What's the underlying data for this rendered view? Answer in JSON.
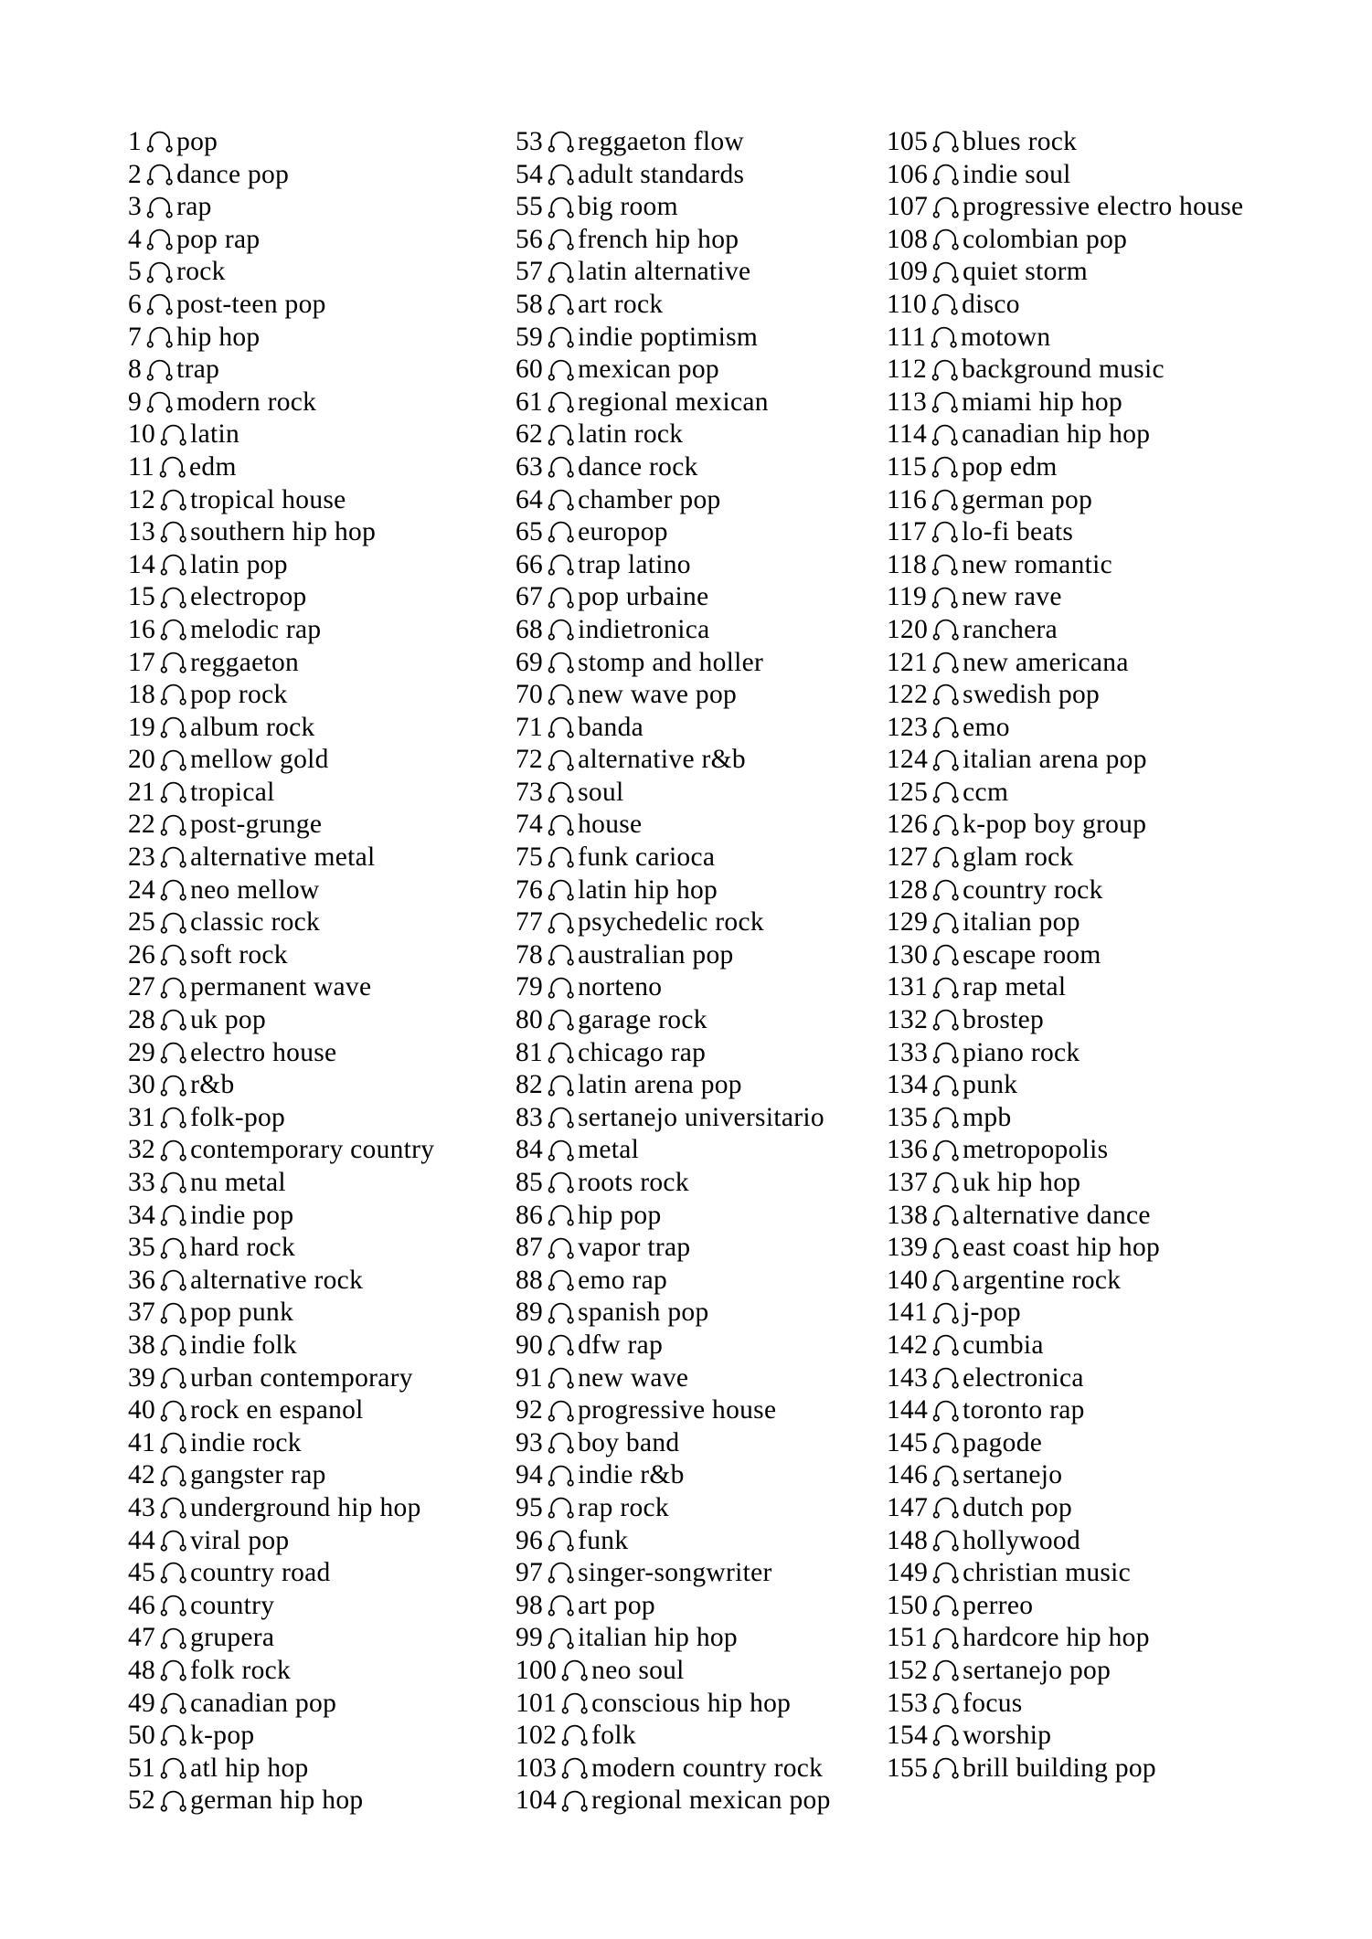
{
  "document": {
    "type": "genre-list",
    "icon_name": "headphones-icon",
    "total_items": 155,
    "background_color": "#ffffff",
    "text_color": "#000000",
    "columns": 3
  },
  "columns": [
    {
      "name": "column-1",
      "items": [
        {
          "n": "1",
          "label": "pop"
        },
        {
          "n": "2",
          "label": "dance pop"
        },
        {
          "n": "3",
          "label": "rap"
        },
        {
          "n": "4",
          "label": "pop rap"
        },
        {
          "n": "5",
          "label": "rock"
        },
        {
          "n": "6",
          "label": "post-teen pop"
        },
        {
          "n": "7",
          "label": "hip hop"
        },
        {
          "n": "8",
          "label": "trap"
        },
        {
          "n": "9",
          "label": "modern rock"
        },
        {
          "n": "10",
          "label": "latin"
        },
        {
          "n": "11",
          "label": "edm"
        },
        {
          "n": "12",
          "label": "tropical house"
        },
        {
          "n": "13",
          "label": "southern hip hop"
        },
        {
          "n": "14",
          "label": "latin pop"
        },
        {
          "n": "15",
          "label": "electropop"
        },
        {
          "n": "16",
          "label": "melodic rap"
        },
        {
          "n": "17",
          "label": "reggaeton"
        },
        {
          "n": "18",
          "label": "pop rock"
        },
        {
          "n": "19",
          "label": "album rock"
        },
        {
          "n": "20",
          "label": "mellow gold"
        },
        {
          "n": "21",
          "label": "tropical"
        },
        {
          "n": "22",
          "label": "post-grunge"
        },
        {
          "n": "23",
          "label": "alternative metal"
        },
        {
          "n": "24",
          "label": "neo mellow"
        },
        {
          "n": "25",
          "label": "classic rock"
        },
        {
          "n": "26",
          "label": "soft rock"
        },
        {
          "n": "27",
          "label": "permanent wave"
        },
        {
          "n": "28",
          "label": "uk pop"
        },
        {
          "n": "29",
          "label": "electro house"
        },
        {
          "n": "30",
          "label": "r&b"
        },
        {
          "n": "31",
          "label": "folk-pop"
        },
        {
          "n": "32",
          "label": "contemporary country"
        },
        {
          "n": "33",
          "label": "nu metal"
        },
        {
          "n": "34",
          "label": "indie pop"
        },
        {
          "n": "35",
          "label": "hard rock"
        },
        {
          "n": "36",
          "label": "alternative rock"
        },
        {
          "n": "37",
          "label": "pop punk"
        },
        {
          "n": "38",
          "label": "indie folk"
        },
        {
          "n": "39",
          "label": "urban contemporary"
        },
        {
          "n": "40",
          "label": "rock en espanol"
        },
        {
          "n": "41",
          "label": "indie rock"
        },
        {
          "n": "42",
          "label": "gangster rap"
        },
        {
          "n": "43",
          "label": "underground hip hop"
        },
        {
          "n": "44",
          "label": "viral pop"
        },
        {
          "n": "45",
          "label": "country road"
        },
        {
          "n": "46",
          "label": "country"
        },
        {
          "n": "47",
          "label": "grupera"
        },
        {
          "n": "48",
          "label": "folk rock"
        },
        {
          "n": "49",
          "label": "canadian pop"
        },
        {
          "n": "50",
          "label": "k-pop"
        },
        {
          "n": "51",
          "label": "atl hip hop"
        },
        {
          "n": "52",
          "label": "german hip hop"
        }
      ]
    },
    {
      "name": "column-2",
      "items": [
        {
          "n": "53",
          "label": "reggaeton flow"
        },
        {
          "n": "54",
          "label": "adult standards"
        },
        {
          "n": "55",
          "label": "big room"
        },
        {
          "n": "56",
          "label": "french hip hop"
        },
        {
          "n": "57",
          "label": "latin alternative"
        },
        {
          "n": "58",
          "label": "art rock"
        },
        {
          "n": "59",
          "label": "indie poptimism"
        },
        {
          "n": "60",
          "label": "mexican pop"
        },
        {
          "n": "61",
          "label": "regional mexican"
        },
        {
          "n": "62",
          "label": "latin rock"
        },
        {
          "n": "63",
          "label": "dance rock"
        },
        {
          "n": "64",
          "label": "chamber pop"
        },
        {
          "n": "65",
          "label": "europop"
        },
        {
          "n": "66",
          "label": "trap latino"
        },
        {
          "n": "67",
          "label": "pop urbaine"
        },
        {
          "n": "68",
          "label": "indietronica"
        },
        {
          "n": "69",
          "label": "stomp and holler"
        },
        {
          "n": "70",
          "label": "new wave pop"
        },
        {
          "n": "71",
          "label": "banda"
        },
        {
          "n": "72",
          "label": "alternative r&b"
        },
        {
          "n": "73",
          "label": "soul"
        },
        {
          "n": "74",
          "label": "house"
        },
        {
          "n": "75",
          "label": "funk carioca"
        },
        {
          "n": "76",
          "label": "latin hip hop"
        },
        {
          "n": "77",
          "label": "psychedelic rock"
        },
        {
          "n": "78",
          "label": "australian pop"
        },
        {
          "n": "79",
          "label": "norteno"
        },
        {
          "n": "80",
          "label": "garage rock"
        },
        {
          "n": "81",
          "label": "chicago rap"
        },
        {
          "n": "82",
          "label": "latin arena pop"
        },
        {
          "n": "83",
          "label": "sertanejo universitario"
        },
        {
          "n": "84",
          "label": "metal"
        },
        {
          "n": "85",
          "label": "roots rock"
        },
        {
          "n": "86",
          "label": "hip pop"
        },
        {
          "n": "87",
          "label": "vapor trap"
        },
        {
          "n": "88",
          "label": "emo rap"
        },
        {
          "n": "89",
          "label": "spanish pop"
        },
        {
          "n": "90",
          "label": "dfw rap"
        },
        {
          "n": "91",
          "label": "new wave"
        },
        {
          "n": "92",
          "label": "progressive house"
        },
        {
          "n": "93",
          "label": "boy band"
        },
        {
          "n": "94",
          "label": "indie r&b"
        },
        {
          "n": "95",
          "label": "rap rock"
        },
        {
          "n": "96",
          "label": "funk"
        },
        {
          "n": "97",
          "label": "singer-songwriter"
        },
        {
          "n": "98",
          "label": "art pop"
        },
        {
          "n": "99",
          "label": "italian hip hop"
        },
        {
          "n": "100",
          "label": "neo soul"
        },
        {
          "n": "101",
          "label": "conscious hip hop"
        },
        {
          "n": "102",
          "label": "folk"
        },
        {
          "n": "103",
          "label": "modern country rock"
        },
        {
          "n": "104",
          "label": "regional mexican pop"
        }
      ]
    },
    {
      "name": "column-3",
      "items": [
        {
          "n": "105",
          "label": "blues rock"
        },
        {
          "n": "106",
          "label": "indie soul"
        },
        {
          "n": "107",
          "label": "progressive electro house"
        },
        {
          "n": "108",
          "label": "colombian pop"
        },
        {
          "n": "109",
          "label": "quiet storm"
        },
        {
          "n": "110",
          "label": "disco"
        },
        {
          "n": "111",
          "label": "motown"
        },
        {
          "n": "112",
          "label": "background music"
        },
        {
          "n": "113",
          "label": "miami hip hop"
        },
        {
          "n": "114",
          "label": "canadian hip hop"
        },
        {
          "n": "115",
          "label": "pop edm"
        },
        {
          "n": "116",
          "label": "german pop"
        },
        {
          "n": "117",
          "label": "lo-fi beats"
        },
        {
          "n": "118",
          "label": "new romantic"
        },
        {
          "n": "119",
          "label": "new rave"
        },
        {
          "n": "120",
          "label": "ranchera"
        },
        {
          "n": "121",
          "label": "new americana"
        },
        {
          "n": "122",
          "label": "swedish pop"
        },
        {
          "n": "123",
          "label": "emo"
        },
        {
          "n": "124",
          "label": "italian arena pop"
        },
        {
          "n": "125",
          "label": "ccm"
        },
        {
          "n": "126",
          "label": "k-pop boy group"
        },
        {
          "n": "127",
          "label": "glam rock"
        },
        {
          "n": "128",
          "label": "country rock"
        },
        {
          "n": "129",
          "label": "italian pop"
        },
        {
          "n": "130",
          "label": "escape room"
        },
        {
          "n": "131",
          "label": "rap metal"
        },
        {
          "n": "132",
          "label": "brostep"
        },
        {
          "n": "133",
          "label": "piano rock"
        },
        {
          "n": "134",
          "label": "punk"
        },
        {
          "n": "135",
          "label": "mpb"
        },
        {
          "n": "136",
          "label": "metropopolis"
        },
        {
          "n": "137",
          "label": "uk hip hop"
        },
        {
          "n": "138",
          "label": "alternative dance"
        },
        {
          "n": "139",
          "label": "east coast hip hop"
        },
        {
          "n": "140",
          "label": "argentine rock"
        },
        {
          "n": "141",
          "label": "j-pop"
        },
        {
          "n": "142",
          "label": "cumbia"
        },
        {
          "n": "143",
          "label": "electronica"
        },
        {
          "n": "144",
          "label": "toronto rap"
        },
        {
          "n": "145",
          "label": "pagode"
        },
        {
          "n": "146",
          "label": "sertanejo"
        },
        {
          "n": "147",
          "label": "dutch pop"
        },
        {
          "n": "148",
          "label": "hollywood"
        },
        {
          "n": "149",
          "label": "christian music"
        },
        {
          "n": "150",
          "label": "perreo"
        },
        {
          "n": "151",
          "label": "hardcore hip hop"
        },
        {
          "n": "152",
          "label": "sertanejo pop"
        },
        {
          "n": "153",
          "label": "focus"
        },
        {
          "n": "154",
          "label": "worship"
        },
        {
          "n": "155",
          "label": "brill building pop"
        }
      ]
    }
  ]
}
